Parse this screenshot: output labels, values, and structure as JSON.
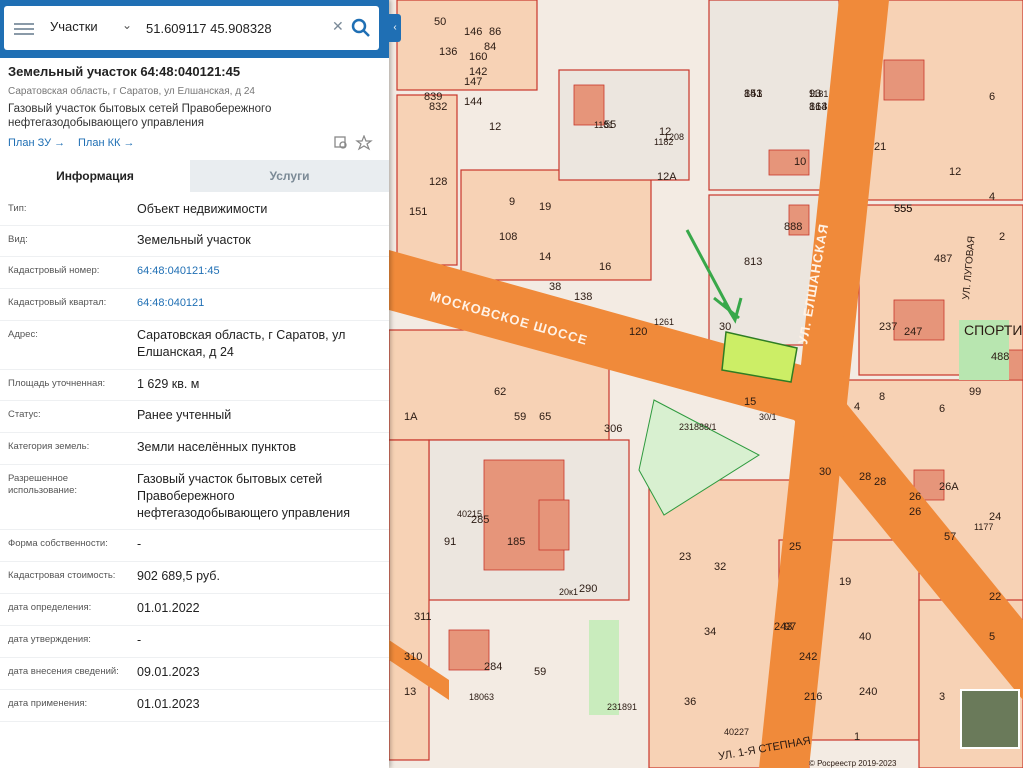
{
  "search": {
    "layer": "Участки",
    "query": "51.609117 45.908328"
  },
  "parcel": {
    "title": "Земельный участок 64:48:040121:45",
    "address_short": "Саратовская область, г Саратов, ул Елшанская, д 24",
    "description": "Газовый участок бытовых сетей Правобережного нефтегазодобывающего управления",
    "plan_zu": "План ЗУ →",
    "plan_kk": "План КК →"
  },
  "tabs": {
    "info": "Информация",
    "services": "Услуги"
  },
  "rows": [
    {
      "k": "Тип:",
      "v": "Объект недвижимости"
    },
    {
      "k": "Вид:",
      "v": "Земельный участок"
    },
    {
      "k": "Кадастровый номер:",
      "v": "64:48:040121:45",
      "link": true
    },
    {
      "k": "Кадастровый квартал:",
      "v": "64:48:040121",
      "link": true
    },
    {
      "k": "Адрес:",
      "v": "Саратовская область, г Саратов, ул Елшанская, д 24"
    },
    {
      "k": "Площадь уточненная:",
      "v": "1 629 кв. м"
    },
    {
      "k": "Статус:",
      "v": "Ранее учтенный"
    },
    {
      "k": "Категория земель:",
      "v": "Земли населённых пунктов"
    },
    {
      "k": "Разрешенное использование:",
      "v": "Газовый участок бытовых сетей Правобережного нефтегазодобывающего управления"
    },
    {
      "k": "Форма собственности:",
      "v": "-"
    },
    {
      "k": "Кадастровая стоимость:",
      "v": "902 689,5 руб."
    },
    {
      "k": "дата определения:",
      "v": "01.01.2022"
    },
    {
      "k": "дата утверждения:",
      "v": "-"
    },
    {
      "k": "дата внесения сведений:",
      "v": "09.01.2023"
    },
    {
      "k": "дата применения:",
      "v": "01.01.2023"
    }
  ],
  "map": {
    "streets": {
      "moskovskoe": "МОСКОВСКОЕ ШОССЕ",
      "elshanskaya": "УЛ. ЕЛШАНСКАЯ",
      "stepnaya": "УЛ. 1-Я СТЕПНАЯ",
      "sportivnaya": "СПОРТИ",
      "lugovaya": "УЛ. ЛУГОВАЯ"
    },
    "labels": [
      "93",
      "841",
      "814",
      "1181",
      "1182",
      "12А",
      "12",
      "813",
      "888",
      "237",
      "247",
      "487",
      "488",
      "555",
      "555",
      "99",
      "30",
      "15",
      "30/1",
      "231888/1",
      "40215",
      "285",
      "185",
      "91",
      "20к1",
      "290",
      "311",
      "310",
      "284",
      "59",
      "18063",
      "231891",
      "40227",
      "97",
      "25",
      "23",
      "32",
      "34",
      "36",
      "30",
      "28",
      "26",
      "24",
      "26А",
      "22",
      "8",
      "6",
      "4",
      "28",
      "26",
      "40",
      "216",
      "242",
      "243",
      "240",
      "19",
      "1",
      "3",
      "5",
      "13",
      "21",
      "12",
      "6",
      "10",
      "4",
      "2",
      "146",
      "142",
      "147",
      "144",
      "160",
      "832",
      "839",
      "136",
      "128",
      "86",
      "84",
      "108",
      "62",
      "59",
      "65",
      "306",
      "1A",
      "16",
      "138",
      "38",
      "9",
      "19",
      "14",
      "120",
      "1261",
      "1208",
      "151",
      "12",
      "50",
      "55",
      "57",
      "1177",
      "1181",
      "153",
      "163"
    ],
    "copyright": "© Росреестр 2019-2023"
  },
  "colors": {
    "header": "#1f6fb4",
    "road": "#f08a3a",
    "parcel": "#ccee66",
    "highlight": "#38a84a"
  }
}
